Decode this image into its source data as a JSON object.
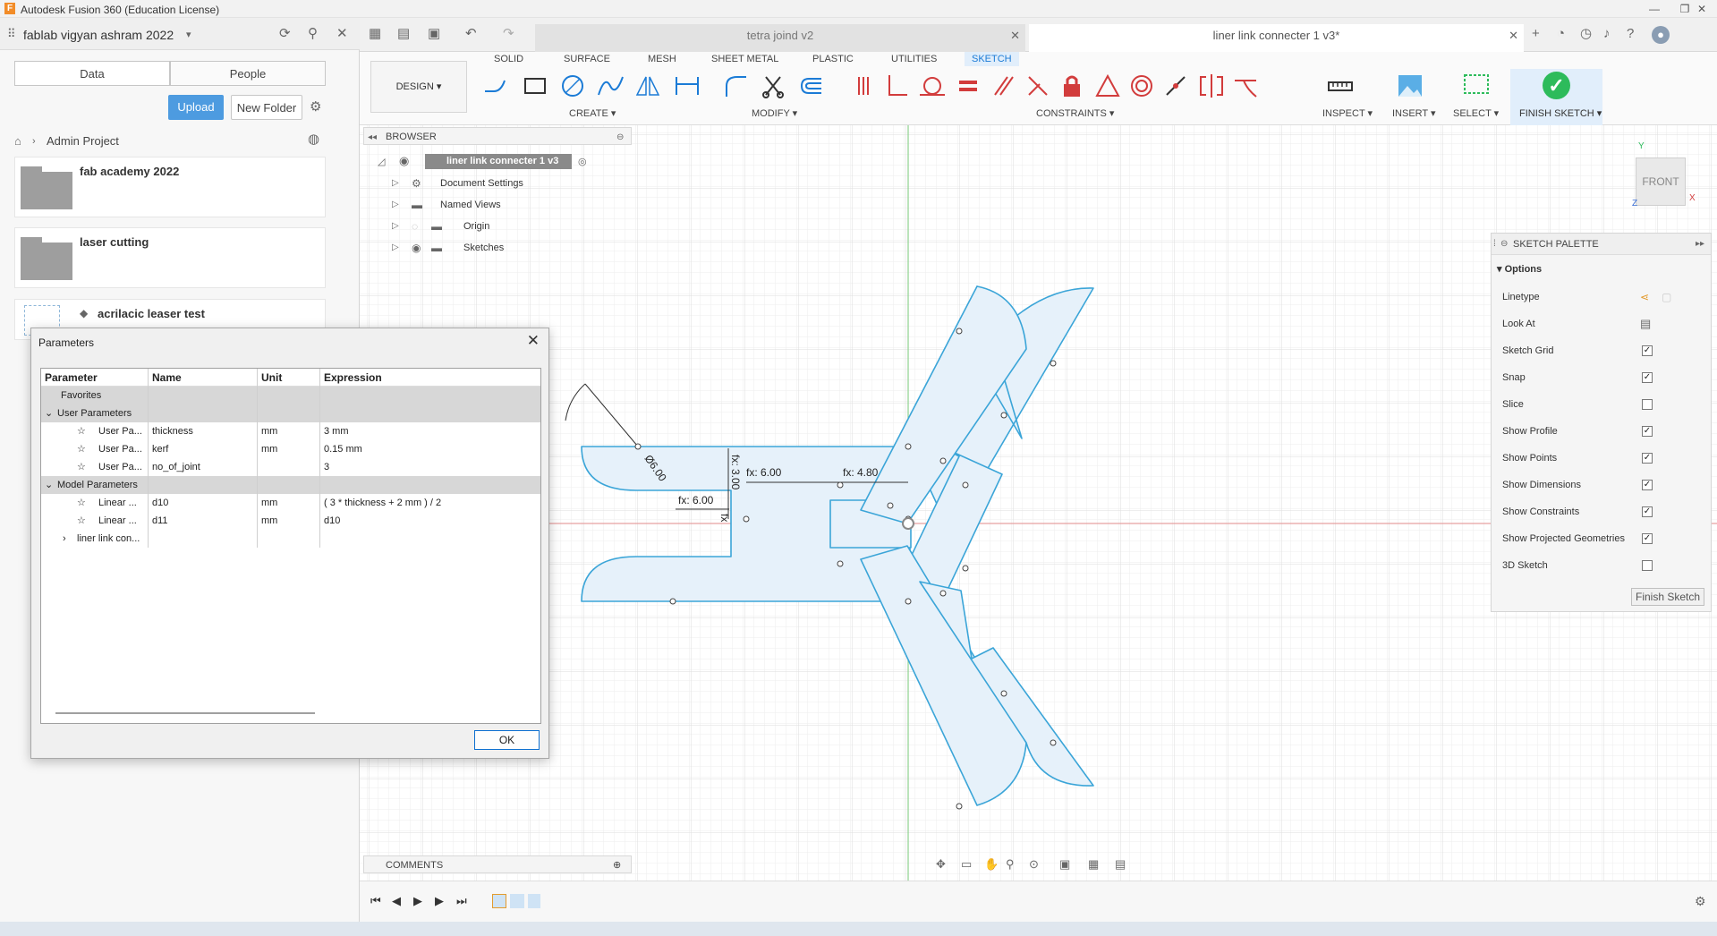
{
  "window": {
    "title": "Autodesk Fusion 360 (Education License)",
    "controls": [
      "—",
      "❐",
      "✕"
    ]
  },
  "datapanel": {
    "hub_name": "fablab vigyan ashram 2022",
    "tabs": [
      "Data",
      "People"
    ],
    "upload_label": "Upload",
    "new_folder_label": "New Folder",
    "breadcrumb": "Admin Project",
    "items": [
      {
        "name": "fab academy 2022",
        "type": "folder"
      },
      {
        "name": "laser cutting",
        "type": "folder"
      },
      {
        "name": "acrilacic leaser test",
        "type": "design"
      }
    ]
  },
  "doc_tabs": [
    {
      "label": "tetra joind v2"
    },
    {
      "label": "liner link connecter 1 v3*"
    }
  ],
  "toolbar": {
    "workspace_tabs": [
      "SOLID",
      "SURFACE",
      "MESH",
      "SHEET METAL",
      "PLASTIC",
      "UTILITIES",
      "SKETCH"
    ],
    "active_tab": "SKETCH",
    "design_label": "DESIGN ▾",
    "groups": [
      "CREATE ▾",
      "MODIFY ▾",
      "CONSTRAINTS ▾",
      "INSPECT ▾",
      "INSERT ▾",
      "SELECT ▾"
    ],
    "finish_sketch_label": "FINISH SKETCH ▾"
  },
  "browser": {
    "title": "BROWSER",
    "root": "liner link connecter 1 v3",
    "items": [
      "Document Settings",
      "Named Views",
      "Origin",
      "Sketches"
    ]
  },
  "viewcube": {
    "face": "FRONT",
    "axis_y": "Y",
    "axis_x": "X",
    "axis_z": "Z"
  },
  "sketch_palette": {
    "title": "SKETCH PALETTE",
    "section": "Options",
    "rows": [
      {
        "label": "Linetype",
        "kind": "icons"
      },
      {
        "label": "Look At",
        "kind": "icon"
      },
      {
        "label": "Sketch Grid",
        "checked": true
      },
      {
        "label": "Snap",
        "checked": true
      },
      {
        "label": "Slice",
        "checked": false
      },
      {
        "label": "Show Profile",
        "checked": true
      },
      {
        "label": "Show Points",
        "checked": true
      },
      {
        "label": "Show Dimensions",
        "checked": true
      },
      {
        "label": "Show Constraints",
        "checked": true
      },
      {
        "label": "Show Projected Geometries",
        "checked": true
      },
      {
        "label": "3D Sketch",
        "checked": false
      }
    ],
    "finish_label": "Finish Sketch"
  },
  "dimensions": {
    "d1": "fx: 6.00",
    "d2": "fx: 4.80",
    "d3": "fx: 6.00",
    "d4": "fx: 3.00",
    "d5": "Ø6.00",
    "d6": "fx"
  },
  "parameters_dialog": {
    "title": "Parameters",
    "columns": [
      "Parameter",
      "Name",
      "Unit",
      "Expression"
    ],
    "rows": [
      {
        "kind": "group",
        "parameter": "Favorites",
        "name": "",
        "unit": "",
        "expression": ""
      },
      {
        "kind": "group",
        "parameter": "User Parameters",
        "name": "",
        "unit": "",
        "expression": ""
      },
      {
        "kind": "item",
        "parameter": "User Pa...",
        "name": "thickness",
        "unit": "mm",
        "expression": "3 mm"
      },
      {
        "kind": "item",
        "parameter": "User Pa...",
        "name": "kerf",
        "unit": "mm",
        "expression": "0.15 mm"
      },
      {
        "kind": "item",
        "parameter": "User Pa...",
        "name": "no_of_joint",
        "unit": "",
        "expression": "3"
      },
      {
        "kind": "group",
        "parameter": "Model Parameters",
        "name": "",
        "unit": "",
        "expression": ""
      },
      {
        "kind": "item",
        "parameter": "Linear ...",
        "name": "d10",
        "unit": "mm",
        "expression": "( 3 * thickness + 2 mm ) / 2"
      },
      {
        "kind": "item",
        "parameter": "Linear ...",
        "name": "d11",
        "unit": "mm",
        "expression": "d10"
      },
      {
        "kind": "sub",
        "parameter": "liner link con...",
        "name": "",
        "unit": "",
        "expression": ""
      }
    ],
    "ok_label": "OK"
  },
  "bottom": {
    "comments_label": "COMMENTS"
  },
  "colors": {
    "accent": "#1b7bd6",
    "sketch_line": "#3ba5d8",
    "sketch_fill": "#e6f1fa",
    "finish_green": "#2dbb5b"
  }
}
